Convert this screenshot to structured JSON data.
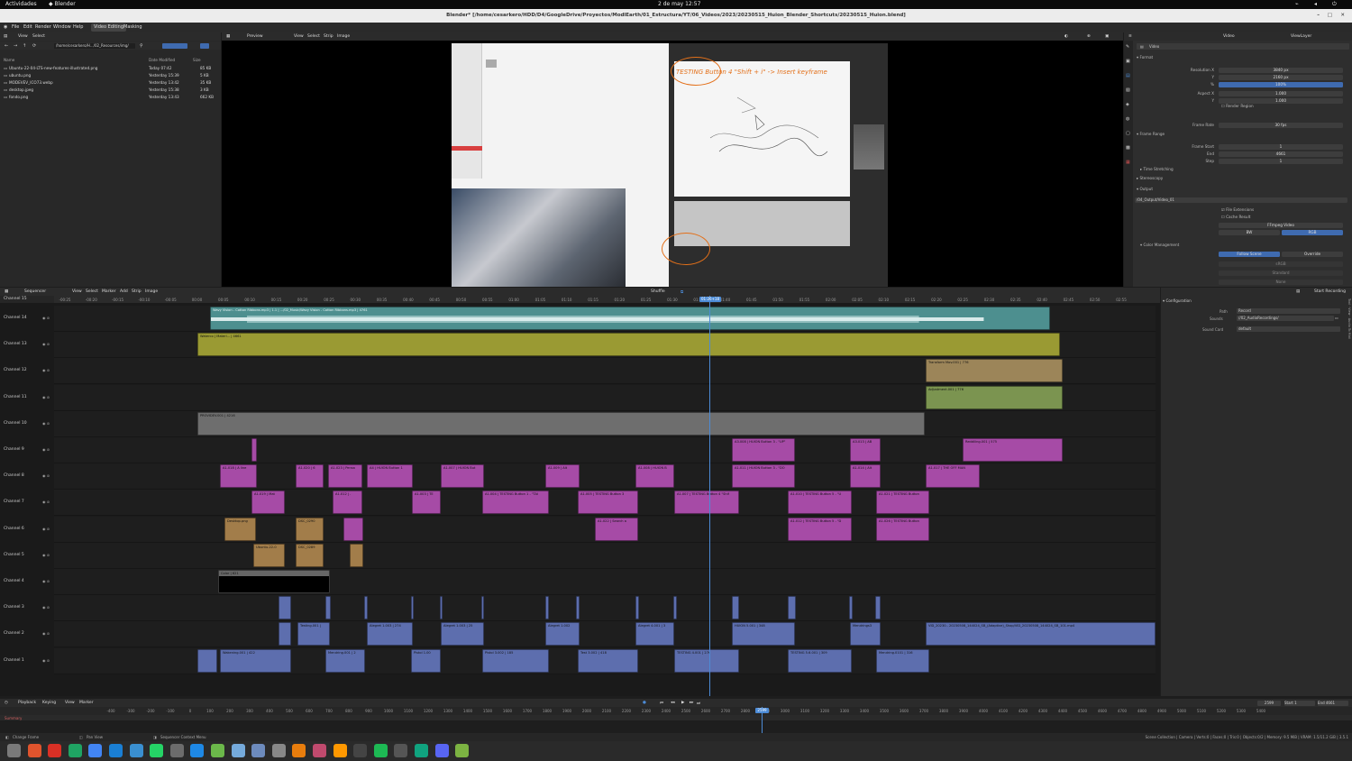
{
  "gnome": {
    "activities": "Actividades",
    "app": "Blender",
    "clock": "2 de may  12:57"
  },
  "window": {
    "title": "Blender* [/home/cesarkero/HDD/D4/GoogleDrive/Proyectos/ModlEarth/01_Estructura/YT/06_Videos/2023/20230515_Huion_Blender_Shortcuts/20230515_Huion.blend]"
  },
  "menu": {
    "items": [
      "File",
      "Edit",
      "Render",
      "Window",
      "Help"
    ],
    "workspaces": [
      "Video Editing",
      "Masking"
    ]
  },
  "filebrowser": {
    "header": [
      "View",
      "Select"
    ],
    "path": "/home/cesarkero/H.../02_Resources/img/",
    "columns": [
      "Name",
      "Date Modified",
      "Size"
    ],
    "files": [
      {
        "name": "Ubuntu-22-04-LTS-new-features-illustrated.png",
        "date": "Today 07:42",
        "size": "85 KB"
      },
      {
        "name": "ubuntu.png",
        "date": "Yesterday 15:39",
        "size": "5 KB"
      },
      {
        "name": "MODEVEV_ICO73.webp",
        "date": "Yesterday 13:42",
        "size": "35 KB"
      },
      {
        "name": "desktop.jpeg",
        "date": "Yesterday 15:38",
        "size": "3 KB"
      },
      {
        "name": "fondo.png",
        "date": "Yesterday 13:43",
        "size": "662 KB"
      }
    ]
  },
  "preview": {
    "header": [
      "Preview",
      "View",
      "Select",
      "Strip",
      "Image"
    ],
    "annotation": "TESTING Button 4 \"Shift + i\" -> Insert keyframe"
  },
  "properties": {
    "header": [
      "Video",
      "ViewLayer"
    ],
    "tab": "Video",
    "sections": {
      "format": "Format",
      "frame_range": "Frame Range",
      "time_stretching": "Time Stretching",
      "stereoscopy": "Stereoscopy",
      "output": "Output",
      "color_management": "Color Management"
    },
    "rows": [
      {
        "label": "Resolution X",
        "value": "3840 px"
      },
      {
        "label": "Y",
        "value": "2160 px"
      },
      {
        "label": "%",
        "value": "100%",
        "accent": true
      },
      {
        "label": "Aspect X",
        "value": "1.000"
      },
      {
        "label": "Y",
        "value": "1.000"
      },
      {
        "label": "Frame Rate",
        "value": "30 fps"
      },
      {
        "label": "Frame Start",
        "value": "1"
      },
      {
        "label": "End",
        "value": "4661"
      },
      {
        "label": "Step",
        "value": "1"
      }
    ],
    "output_path": "/04_Output/Video_01",
    "output_checks": [
      "File Extensions",
      "Cache Result"
    ],
    "file_format": "FFmpeg Video",
    "color_modes": [
      "BW",
      "RGB"
    ],
    "render_region": "Render Region",
    "follow_scene": "Follow Scene",
    "override": "Override",
    "display_device": "sRGB",
    "view": "Standard",
    "look": "None"
  },
  "sequencer": {
    "header": [
      "Sequencer",
      "View",
      "Select",
      "Marker",
      "Add",
      "Strip",
      "Image"
    ],
    "shuffle": "Shuffle",
    "playhead": "01:26+18",
    "ruler": [
      "-00:25",
      "-00:20",
      "-00:15",
      "-00:10",
      "-00:05",
      "00:00",
      "00:05",
      "00:10",
      "00:15",
      "00:20",
      "00:25",
      "00:30",
      "00:35",
      "00:40",
      "00:45",
      "00:50",
      "00:55",
      "01:00",
      "01:05",
      "01:10",
      "01:15",
      "01:20",
      "01:25",
      "01:30",
      "01:35",
      "01:40",
      "01:45",
      "01:50",
      "01:55",
      "02:00",
      "02:05",
      "02:10",
      "02:15",
      "02:20",
      "02:25",
      "02:30",
      "02:35",
      "02:40",
      "02:45",
      "02:50",
      "02:55"
    ],
    "channels": [
      "Channel 15",
      "Channel 14",
      "Channel 13",
      "Channel 12",
      "Channel 11",
      "Channel 10",
      "Channel 9",
      "Channel 8",
      "Channel 7",
      "Channel 6",
      "Channel 5",
      "Channel 4",
      "Channel 3",
      "Channel 2",
      "Channel 1"
    ],
    "strips": [
      {
        "ch": 14,
        "s": 233,
        "e": 1165,
        "t": "sound",
        "label": "Wavy Vision - Cotton Ribbons.mp3 | 1.1 | .../02_Music/Wavy Vision - Cotton Ribbons.mp3 | 4761"
      },
      {
        "ch": 13,
        "s": 219,
        "e": 1176,
        "t": "meta",
        "label": "Waterco | Materi... | 4661"
      },
      {
        "ch": 12,
        "s": 1027,
        "e": 1179,
        "t": "trans",
        "label": "Transform Mov.001 | 776"
      },
      {
        "ch": 11,
        "s": 1027,
        "e": 1179,
        "t": "adj",
        "label": "Adjustment.001 | 776"
      },
      {
        "ch": 10,
        "s": 219,
        "e": 1026,
        "t": "movie",
        "label": "PROVIDEV.001 | 4216"
      },
      {
        "ch": 9,
        "s": 279,
        "e": 285,
        "t": "text",
        "label": ""
      },
      {
        "ch": 9,
        "s": 812,
        "e": 882,
        "t": "text",
        "label": "A3.008 | HUION Button 3 - \"UP\""
      },
      {
        "ch": 9,
        "s": 943,
        "e": 977,
        "t": "text",
        "label": "A3.013 | AB"
      },
      {
        "ch": 9,
        "s": 1068,
        "e": 1179,
        "t": "text",
        "label": "Reddiling.001 | 575"
      },
      {
        "ch": 8,
        "s": 244,
        "e": 285,
        "t": "text",
        "label": "A1.018 | A line"
      },
      {
        "ch": 8,
        "s": 328,
        "e": 359,
        "t": "text",
        "label": "A1.020 | 6"
      },
      {
        "ch": 8,
        "s": 364,
        "e": 402,
        "t": "text",
        "label": "A1.023 | Pensa"
      },
      {
        "ch": 8,
        "s": 407,
        "e": 458,
        "t": "text",
        "label": "A4 | HUION Button 1"
      },
      {
        "ch": 8,
        "s": 489,
        "e": 537,
        "t": "text",
        "label": "A1.007 | HUION But"
      },
      {
        "ch": 8,
        "s": 605,
        "e": 643,
        "t": "text",
        "label": "A1.009 | Alt"
      },
      {
        "ch": 8,
        "s": 705,
        "e": 748,
        "t": "text",
        "label": "A1.008 | HUION B"
      },
      {
        "ch": 8,
        "s": 812,
        "e": 882,
        "t": "text",
        "label": "A1.011 | HUION Button 3 - \"DO"
      },
      {
        "ch": 8,
        "s": 943,
        "e": 977,
        "t": "text",
        "label": "A1.014 | Alt"
      },
      {
        "ch": 8,
        "s": 1027,
        "e": 1087,
        "t": "text",
        "label": "A1.017 | THE OFF MAN"
      },
      {
        "ch": 7,
        "s": 279,
        "e": 316,
        "t": "text",
        "label": "A1.019 | Mat"
      },
      {
        "ch": 7,
        "s": 369,
        "e": 402,
        "t": "text",
        "label": "A1.012 | ."
      },
      {
        "ch": 7,
        "s": 457,
        "e": 489,
        "t": "text",
        "label": "A1.003 | TE"
      },
      {
        "ch": 7,
        "s": 535,
        "e": 609,
        "t": "text",
        "label": "A1.004 | TESTING Button 1 - \"TAI"
      },
      {
        "ch": 7,
        "s": 641,
        "e": 708,
        "t": "text",
        "label": "A1.005 | TESTING Button 3"
      },
      {
        "ch": 7,
        "s": 748,
        "e": 820,
        "t": "text",
        "label": "A1.007 | TESTING Button 4 \"Shif"
      },
      {
        "ch": 7,
        "s": 874,
        "e": 945,
        "t": "text",
        "label": "A1.010 | TESTING Button 5 - \"U"
      },
      {
        "ch": 7,
        "s": 972,
        "e": 1031,
        "t": "text",
        "label": "A1.021 | TESTING Button"
      },
      {
        "ch": 6,
        "s": 249,
        "e": 284,
        "t": "image",
        "label": "Desktop.png"
      },
      {
        "ch": 6,
        "s": 328,
        "e": 359,
        "t": "image",
        "label": "DSC_0290"
      },
      {
        "ch": 6,
        "s": 381,
        "e": 403,
        "t": "text",
        "label": ""
      },
      {
        "ch": 6,
        "s": 660,
        "e": 708,
        "t": "text",
        "label": "A1.022 | Search a"
      },
      {
        "ch": 6,
        "s": 874,
        "e": 945,
        "t": "text",
        "label": "A1.012 | TESTING Button 5 - \"D"
      },
      {
        "ch": 6,
        "s": 972,
        "e": 1031,
        "t": "text",
        "label": "A1.026 | TESTING Button"
      },
      {
        "ch": 5,
        "s": 281,
        "e": 316,
        "t": "image",
        "label": "Ubuntu-22-0"
      },
      {
        "ch": 5,
        "s": 328,
        "e": 359,
        "t": "image",
        "label": "DSC_0289"
      },
      {
        "ch": 5,
        "s": 388,
        "e": 403,
        "t": "image",
        "label": ""
      },
      {
        "ch": 4,
        "s": 242,
        "e": 366,
        "t": "color",
        "label": "Color | 621"
      },
      {
        "ch": 3,
        "s": 309,
        "e": 323,
        "t": "clip",
        "label": ""
      },
      {
        "ch": 3,
        "s": 361,
        "e": 367,
        "t": "clip",
        "label": ""
      },
      {
        "ch": 3,
        "s": 404,
        "e": 408,
        "t": "clip",
        "label": ""
      },
      {
        "ch": 3,
        "s": 456,
        "e": 459,
        "t": "clip",
        "label": ""
      },
      {
        "ch": 3,
        "s": 488,
        "e": 491,
        "t": "clip",
        "label": ""
      },
      {
        "ch": 3,
        "s": 534,
        "e": 537,
        "t": "clip",
        "label": ""
      },
      {
        "ch": 3,
        "s": 605,
        "e": 609,
        "t": "clip",
        "label": ""
      },
      {
        "ch": 3,
        "s": 639,
        "e": 643,
        "t": "clip",
        "label": ""
      },
      {
        "ch": 3,
        "s": 705,
        "e": 709,
        "t": "clip",
        "label": ""
      },
      {
        "ch": 3,
        "s": 747,
        "e": 751,
        "t": "clip",
        "label": ""
      },
      {
        "ch": 3,
        "s": 812,
        "e": 820,
        "t": "clip",
        "label": ""
      },
      {
        "ch": 3,
        "s": 874,
        "e": 883,
        "t": "clip",
        "label": ""
      },
      {
        "ch": 3,
        "s": 942,
        "e": 946,
        "t": "clip",
        "label": ""
      },
      {
        "ch": 3,
        "s": 971,
        "e": 977,
        "t": "clip",
        "label": ""
      },
      {
        "ch": 2,
        "s": 309,
        "e": 323,
        "t": "clip",
        "label": ""
      },
      {
        "ch": 2,
        "s": 330,
        "e": 366,
        "t": "clip",
        "label": "Testing.001 |"
      },
      {
        "ch": 2,
        "s": 407,
        "e": 458,
        "t": "clip",
        "label": "Alegret 1.003 | 274"
      },
      {
        "ch": 2,
        "s": 489,
        "e": 537,
        "t": "clip",
        "label": "Alegret 1.003 | 25"
      },
      {
        "ch": 2,
        "s": 605,
        "e": 643,
        "t": "clip",
        "label": "Alegret 1.002"
      },
      {
        "ch": 2,
        "s": 705,
        "e": 748,
        "t": "clip",
        "label": "Alegret 4.001 | 3"
      },
      {
        "ch": 2,
        "s": 812,
        "e": 882,
        "t": "clip",
        "label": "HUION 5.001 | 348"
      },
      {
        "ch": 2,
        "s": 943,
        "e": 977,
        "t": "clip",
        "label": "Mendrings3"
      },
      {
        "ch": 2,
        "s": 1027,
        "e": 1282,
        "t": "clip",
        "label": "VID_20230.. 20230508_144024_SB_(Adaptive)_Shop/VID_20230508_144024_SB_101.mp4"
      },
      {
        "ch": 1,
        "s": 219,
        "e": 241,
        "t": "clip",
        "label": ""
      },
      {
        "ch": 1,
        "s": 244,
        "e": 323,
        "t": "clip",
        "label": "Wakening.001 | 422"
      },
      {
        "ch": 1,
        "s": 361,
        "e": 405,
        "t": "clip",
        "label": "Mendring.001 | 2"
      },
      {
        "ch": 1,
        "s": 456,
        "e": 489,
        "t": "clip",
        "label": "Pistol 1.00"
      },
      {
        "ch": 1,
        "s": 535,
        "e": 609,
        "t": "clip",
        "label": "Pistol 3.002 | 185"
      },
      {
        "ch": 1,
        "s": 641,
        "e": 708,
        "t": "clip",
        "label": "Test 3.002 | 418"
      },
      {
        "ch": 1,
        "s": 748,
        "e": 820,
        "t": "clip",
        "label": "TESTING 4.001 | 276"
      },
      {
        "ch": 1,
        "s": 874,
        "e": 945,
        "t": "clip",
        "label": "TESTING 5.6.001 | 309"
      },
      {
        "ch": 1,
        "s": 972,
        "e": 1031,
        "t": "clip",
        "label": "Mendring.0101 | 316"
      }
    ],
    "side": {
      "start_recording": "Start Recording",
      "configuration": "Configuration",
      "path_label": "Path",
      "path": "Record",
      "sounds_label": "Sounds",
      "sounds": "//02_AudioRecordings/",
      "sound_card_label": "Sound Card",
      "sound_card": "default"
    }
  },
  "timeline": {
    "header": [
      "Playback",
      "Keying",
      "View",
      "Marker"
    ],
    "current_frame": "2599",
    "start_label": "Start",
    "start": "1",
    "end_label": "End",
    "end": "4661",
    "ruler": [
      "-400",
      "-300",
      "-200",
      "-100",
      "0",
      "100",
      "200",
      "300",
      "400",
      "500",
      "600",
      "700",
      "800",
      "900",
      "1000",
      "1100",
      "1200",
      "1300",
      "1400",
      "1500",
      "1600",
      "1700",
      "1800",
      "1900",
      "2000",
      "2100",
      "2200",
      "2300",
      "2400",
      "2500",
      "2600",
      "2700",
      "2800",
      "2900",
      "3000",
      "3100",
      "3200",
      "3300",
      "3400",
      "3500",
      "3600",
      "3700",
      "3800",
      "3900",
      "4000",
      "4100",
      "4200",
      "4300",
      "4400",
      "4500",
      "4600",
      "4700",
      "4800",
      "4900",
      "5000",
      "5100",
      "5200",
      "5300",
      "5400"
    ],
    "summary": "Summary"
  },
  "status": {
    "left": "Change Frame",
    "pan": "Pan View",
    "menu": "Sequencer Context Menu",
    "right": "Scene Collection | Camera | Verts:0 | Faces:0 | Tris:0 | Objects:0/2 | Memory: 9.5 MiB | VRAM: 1.5/11.2 GiB | 3.5.1"
  },
  "colors": {
    "accent": "#4c8bd6",
    "annotation": "#e3701a",
    "sound": "#4d8f8f",
    "text_strip": "#a64ba6",
    "clip": "#5d6eae"
  },
  "dock": [
    "files",
    "brave",
    "gmail",
    "drive",
    "chrome",
    "vscode",
    "app",
    "whatsapp",
    "obs",
    "calendar",
    "qgis",
    "rstudio",
    "kdenlive",
    "mail",
    "blender",
    "davinci",
    "sublime",
    "terminal",
    "spotify",
    "notes",
    "chatgpt",
    "discord",
    "app2"
  ]
}
